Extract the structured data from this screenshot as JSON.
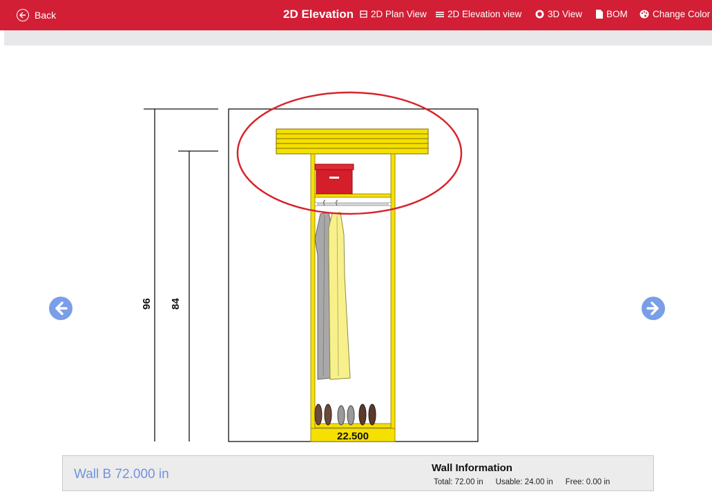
{
  "header": {
    "back_label": "Back",
    "title": "2D Elevation",
    "nav": [
      {
        "label": "2D Plan View",
        "icon": "plan-view-icon"
      },
      {
        "label": "2D Elevation view",
        "icon": "list-icon"
      },
      {
        "label": "3D View",
        "icon": "cube-icon"
      },
      {
        "label": "BOM",
        "icon": "document-icon"
      },
      {
        "label": "Change Color",
        "icon": "palette-icon"
      }
    ]
  },
  "drawing": {
    "dimension_total": "96",
    "dimension_usable": "84",
    "section_width": "22.500"
  },
  "footer": {
    "wall_name": "Wall B 72.000 in",
    "info_title": "Wall Information",
    "total": "Total: 72.00 in",
    "usable": "Usable: 24.00 in",
    "free": "Free: 0.00 in"
  },
  "colors": {
    "header_bg": "#d21f36",
    "accent_blue": "#7a9ee8",
    "closet_yellow": "#f5e000",
    "highlight_red": "#d8232a"
  }
}
